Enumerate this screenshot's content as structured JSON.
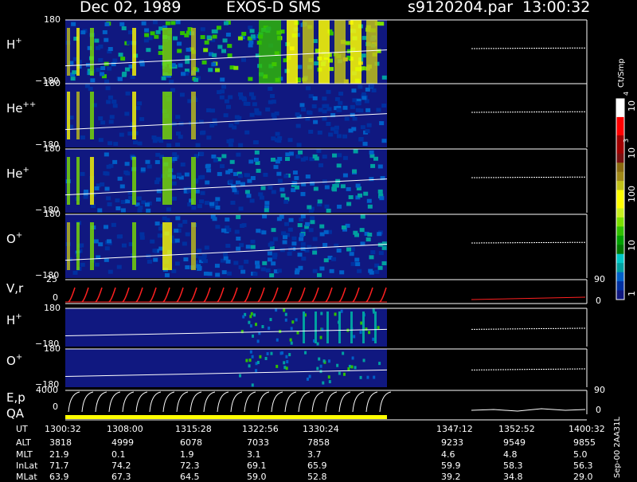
{
  "header": {
    "date": "Dec 02, 1989",
    "instrument": "EXOS-D SMS",
    "file": "s9120204.par",
    "time": "13:00:32"
  },
  "colorbar": {
    "unit": "Ct/Smp",
    "ticks": [
      "10",
      "4",
      "10",
      "3",
      "100",
      "10",
      "1"
    ],
    "colors": [
      "#ffffff",
      "#ffffff",
      "#ff0000",
      "#ff0000",
      "#a00000",
      "#a00000",
      "#7a1010",
      "#8a6a10",
      "#a08818",
      "#c0c018",
      "#ffff00",
      "#ffff00",
      "#c8f020",
      "#7ce000",
      "#30c000",
      "#00a000",
      "#007800",
      "#00c8c8",
      "#00a0a0",
      "#0060c8",
      "#0030a0",
      "#101880"
    ]
  },
  "panels": [
    {
      "species": "H",
      "charge": "+",
      "top": "180",
      "bottom": "−180"
    },
    {
      "species": "He",
      "charge": "++",
      "top": "180",
      "bottom": "−180"
    },
    {
      "species": "He",
      "charge": "+",
      "top": "180",
      "bottom": "−180"
    },
    {
      "species": "O",
      "charge": "+",
      "top": "180",
      "bottom": "−180"
    }
  ],
  "vr_panel": {
    "label": "V,r",
    "top": "25",
    "bottom": "0",
    "right_top": "90",
    "right_bottom": "0"
  },
  "lower_panels": [
    {
      "species": "H",
      "charge": "+",
      "top": "180",
      "bottom": "−180"
    },
    {
      "species": "O",
      "charge": "+",
      "top": "180",
      "bottom": "−180"
    }
  ],
  "ep_panel": {
    "label": "E,p",
    "label2": "QA",
    "top": "4000",
    "bottom": "0",
    "right_top": "90",
    "right_bottom": "0"
  },
  "footer": {
    "row_labels": [
      "UT",
      "ALT",
      "MLT",
      "InLat",
      "MLat"
    ],
    "columns": [
      [
        "1300:32",
        "3818",
        "21.9",
        "71.7",
        "63.9"
      ],
      [
        "1308:00",
        "4999",
        "0.1",
        "74.2",
        "67.3"
      ],
      [
        "1315:28",
        "6078",
        "1.9",
        "72.3",
        "64.5"
      ],
      [
        "1322:56",
        "7033",
        "3.1",
        "69.1",
        "59.0"
      ],
      [
        "1330:24",
        "7858",
        "3.7",
        "65.9",
        "52.8"
      ],
      [
        "1347:12",
        "9233",
        "4.6",
        "59.9",
        "39.2"
      ],
      [
        "1352:52",
        "9549",
        "4.8",
        "58.3",
        "34.8"
      ],
      [
        "1400:32",
        "9855",
        "5.0",
        "56.3",
        "29.0"
      ]
    ],
    "side_note": "Sep-00  2AA31L"
  },
  "chart_data": {
    "type": "heatmap",
    "title": "Dec 02, 1989   EXOS-D SMS",
    "x_tick_labels": [
      "1300:32",
      "1308:00",
      "1315:28",
      "1322:56",
      "1330:24",
      "1347:12",
      "1352:52",
      "1400:32"
    ],
    "y_range_pitch_panels": [
      -180,
      180
    ],
    "colorbar_unit": "Ct/Smp",
    "colorbar_range": [
      1,
      10000
    ],
    "log_scale": true,
    "data_coverage": "1300:32–1335:30; data gap afterwards"
  }
}
